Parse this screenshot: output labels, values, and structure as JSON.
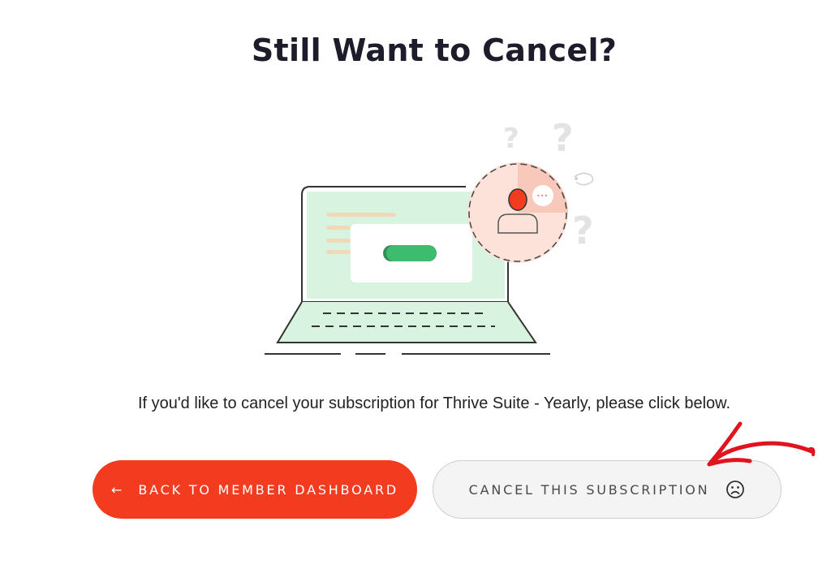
{
  "page": {
    "title": "Still Want to Cancel?",
    "description": "If you'd like to cancel your subscription for Thrive Suite - Yearly, please click below."
  },
  "buttons": {
    "back_arrow": "←",
    "back_label": "BACK TO MEMBER DASHBOARD",
    "cancel_label": "CANCEL THIS SUBSCRIPTION"
  },
  "illustration": {
    "speech_bubble_dots": "•••",
    "question_marks": [
      "?",
      "?",
      "?"
    ]
  },
  "colors": {
    "accent_red": "#f33b1f",
    "title_text": "#1d1c2b",
    "cancel_bg": "#f4f4f4",
    "laptop_green": "#d8f3df",
    "toggle_green": "#3dbb6e",
    "annotation_red": "#e0141e"
  },
  "icons": {
    "back_button": "arrow-left-icon",
    "cancel_button": "sad-face-icon",
    "annotation": "hand-drawn-arrow-icon"
  }
}
